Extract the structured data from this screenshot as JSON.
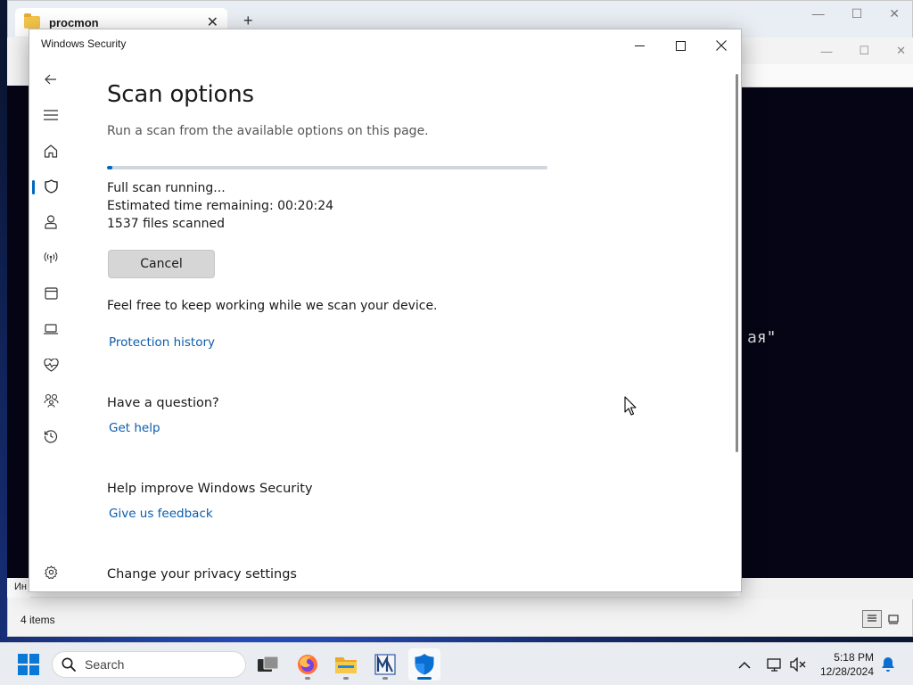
{
  "explorer": {
    "tab_title": "procmon",
    "status_items": "4 items"
  },
  "background": {
    "terminal_text": "ая\"",
    "left_strip_text": "Ин"
  },
  "window": {
    "title": "Windows Security"
  },
  "nav": {
    "items": [
      {
        "name": "back-icon"
      },
      {
        "name": "menu-icon"
      },
      {
        "name": "home-icon"
      },
      {
        "name": "shield-icon",
        "active": true
      },
      {
        "name": "account-icon"
      },
      {
        "name": "network-icon"
      },
      {
        "name": "app-browser-icon"
      },
      {
        "name": "device-icon"
      },
      {
        "name": "health-icon"
      },
      {
        "name": "family-icon"
      },
      {
        "name": "history-icon"
      },
      {
        "name": "settings-icon"
      }
    ]
  },
  "page": {
    "title": "Scan options",
    "subtitle": "Run a scan from the available options on this page.",
    "progress": 0.012,
    "scan_status": "Full scan running...",
    "time_remaining_label": "Estimated time remaining:",
    "time_remaining_value": "00:20:24",
    "files_scanned": "1537 files scanned",
    "cancel_label": "Cancel",
    "keep_working": "Feel free to keep working while we scan your device.",
    "protection_history_link": "Protection history",
    "question_heading": "Have a question?",
    "get_help_link": "Get help",
    "improve_heading": "Help improve Windows Security",
    "feedback_link": "Give us feedback",
    "privacy_heading": "Change your privacy settings"
  },
  "taskbar": {
    "search_placeholder": "Search",
    "time": "5:18 PM",
    "date": "12/28/2024",
    "accent": "#0067c0"
  }
}
